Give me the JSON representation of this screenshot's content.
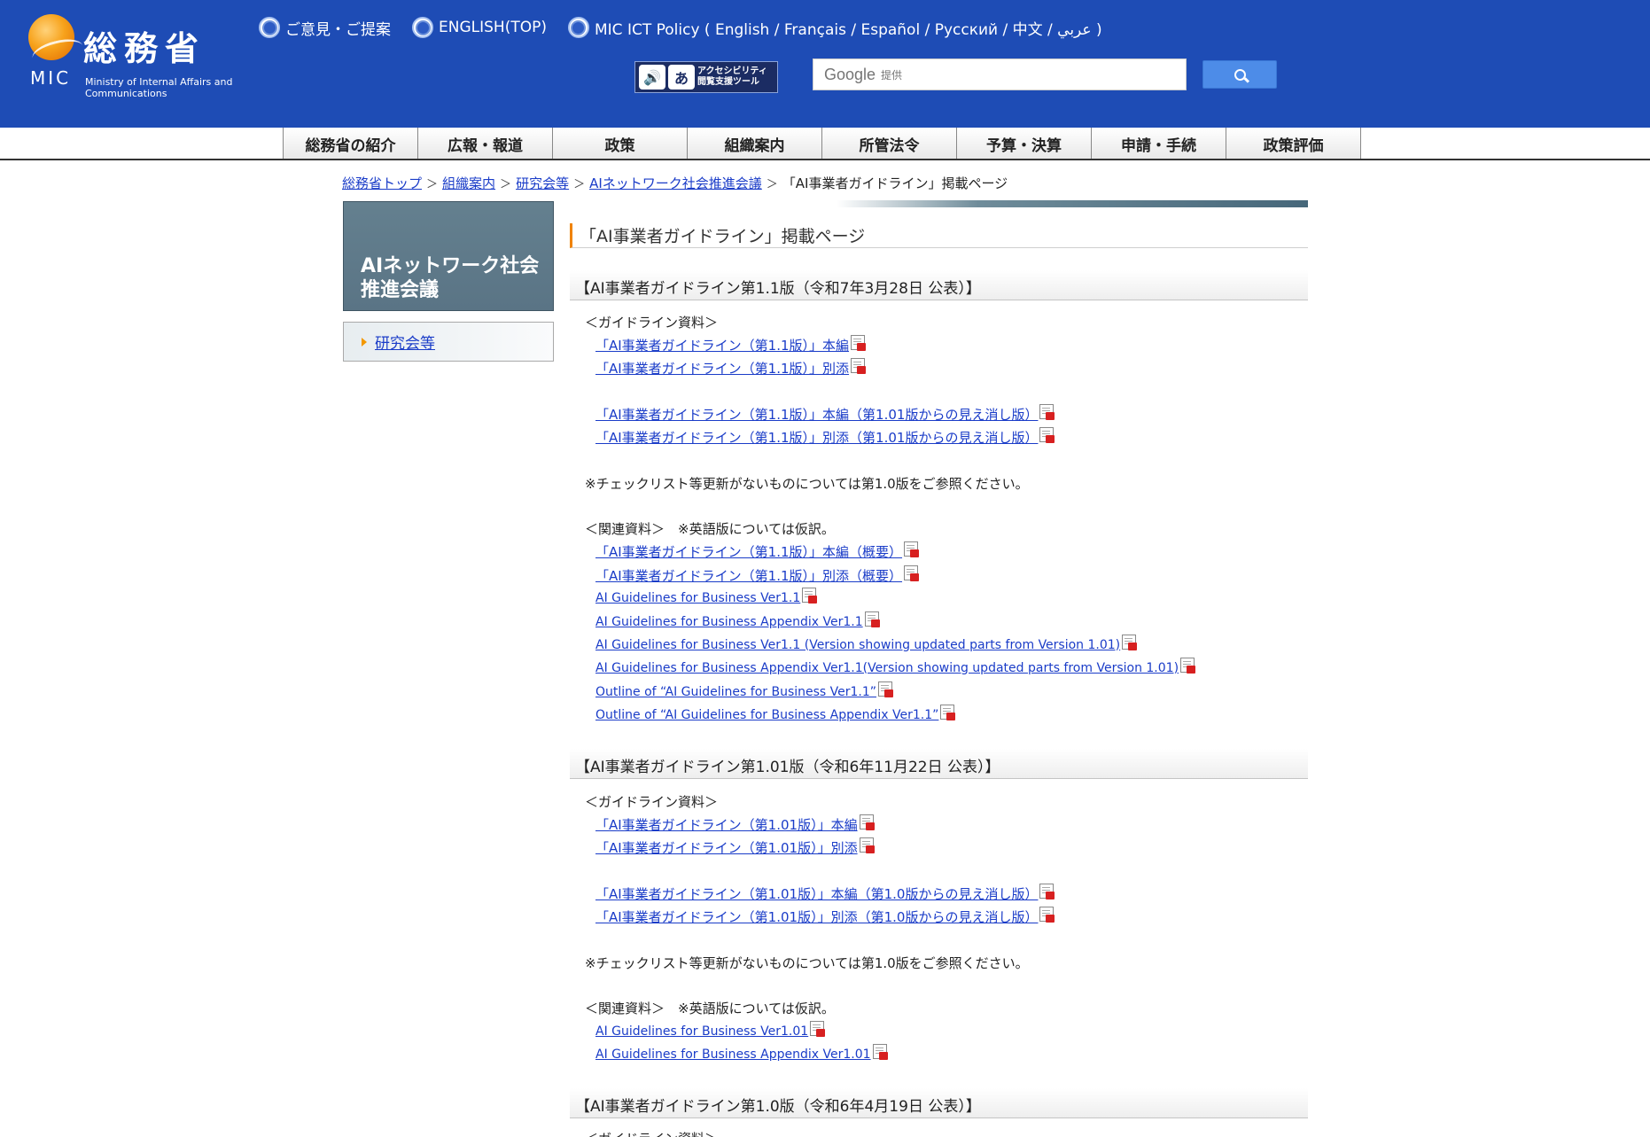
{
  "header": {
    "logo_kanji": "総務省",
    "logo_abbr": "MIC",
    "logo_full": "Ministry of Internal Affairs and Communications",
    "top_links": [
      {
        "label": "ご意見・ご提案"
      },
      {
        "label": "ENGLISH(TOP)"
      },
      {
        "label": "MIC ICT Policy ( English / Français / Español / Русский / 中文 / عربي )"
      }
    ],
    "accessibility_tool": {
      "icon_char": "あ",
      "line1": "アクセシビリティ",
      "line2": "閲覧支援ツール"
    },
    "search": {
      "brand": "Google",
      "suffix": "提供"
    }
  },
  "global_nav": [
    {
      "label": "総務省の紹介"
    },
    {
      "label": "広報・報道"
    },
    {
      "label": "政策"
    },
    {
      "label": "組織案内"
    },
    {
      "label": "所管法令"
    },
    {
      "label": "予算・決算"
    },
    {
      "label": "申請・手続"
    },
    {
      "label": "政策評価"
    }
  ],
  "breadcrumb": {
    "items": [
      {
        "label": "総務省トップ"
      },
      {
        "label": "組織案内"
      },
      {
        "label": "研究会等"
      },
      {
        "label": "AIネットワーク社会推進会議"
      }
    ],
    "separator": "＞",
    "current": "「AI事業者ガイドライン」掲載ページ"
  },
  "sidebar": {
    "title_line1": "AIネットワーク社会",
    "title_line2": "推進会議",
    "link": "研究会等"
  },
  "main": {
    "page_title": "「AI事業者ガイドライン」掲載ページ",
    "sections": [
      {
        "heading": "【AI事業者ガイドライン第1.1版（令和7年3月28日 公表）】",
        "guideline_label": "＜ガイドライン資料＞",
        "guideline_links": [
          "「AI事業者ガイドライン（第1.1版）」本編",
          "「AI事業者ガイドライン（第1.1版）」別添",
          "「AI事業者ガイドライン（第1.1版）」本編（第1.01版からの見え消し版）",
          "「AI事業者ガイドライン（第1.1版）」別添（第1.01版からの見え消し版）"
        ],
        "note": "※チェックリスト等更新がないものについては第1.0版をご参照ください。",
        "related_label": "＜関連資料＞　※英語版については仮訳。",
        "related_links": [
          "「AI事業者ガイドライン（第1.1版）」本編（概要）",
          "「AI事業者ガイドライン（第1.1版）」別添（概要）",
          "AI Guidelines for Business Ver1.1",
          "AI Guidelines for Business Appendix Ver1.1",
          "AI Guidelines for Business Ver1.1 (Version showing updated parts from Version 1.01)",
          "AI Guidelines for Business Appendix Ver1.1(Version showing updated parts from Version 1.01)",
          "Outline of “AI Guidelines for Business Ver1.1”",
          "Outline of “AI Guidelines for Business Appendix Ver1.1”"
        ]
      },
      {
        "heading": "【AI事業者ガイドライン第1.01版（令和6年11月22日 公表）】",
        "guideline_label": "＜ガイドライン資料＞",
        "guideline_links": [
          "「AI事業者ガイドライン（第1.01版）」本編",
          "「AI事業者ガイドライン（第1.01版）」別添",
          "「AI事業者ガイドライン（第1.01版）」本編（第1.0版からの見え消し版）",
          "「AI事業者ガイドライン（第1.01版）」別添（第1.0版からの見え消し版）"
        ],
        "note": "※チェックリスト等更新がないものについては第1.0版をご参照ください。",
        "related_label": "＜関連資料＞　※英語版については仮訳。",
        "related_links": [
          "AI Guidelines for Business Ver1.01",
          "AI Guidelines for Business Appendix Ver1.01"
        ]
      },
      {
        "heading": "【AI事業者ガイドライン第1.0版（令和6年4月19日 公表）】",
        "guideline_label": "＜ガイドライン資料＞"
      }
    ]
  }
}
